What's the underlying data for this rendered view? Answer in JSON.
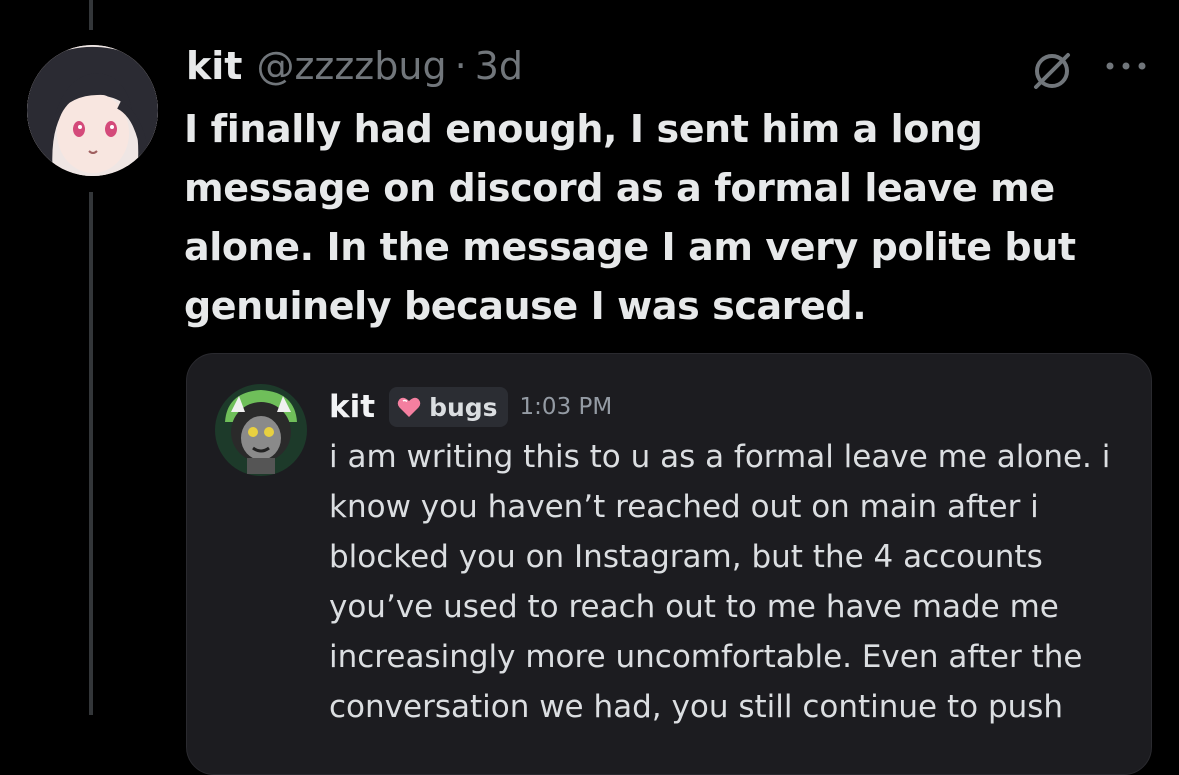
{
  "tweet": {
    "display_name": "kit",
    "handle": "@zzzzbug",
    "separator": "·",
    "time": "3d",
    "text": "I finally had enough, I sent him a long message on discord as a formal leave me alone. In the message I am very polite but genuinely because I was scared."
  },
  "icons": {
    "grok": "grok-icon",
    "more": "more-options-icon"
  },
  "discord": {
    "username": "kit",
    "server_tag": "bugs",
    "time": "1:03 PM",
    "message": "i am writing this to u as a formal leave me alone. i know you haven’t reached out on main after i blocked you on Instagram, but the 4 accounts you’ve used to reach out to me have made me increasingly more uncomfortable. Even after the conversation we had, you still continue to push"
  },
  "colors": {
    "background": "#000000",
    "primary_text": "#e7e9ea",
    "secondary_text": "#71767b",
    "card_background": "#1c1c20",
    "tag_heart": "#f47fa0"
  }
}
